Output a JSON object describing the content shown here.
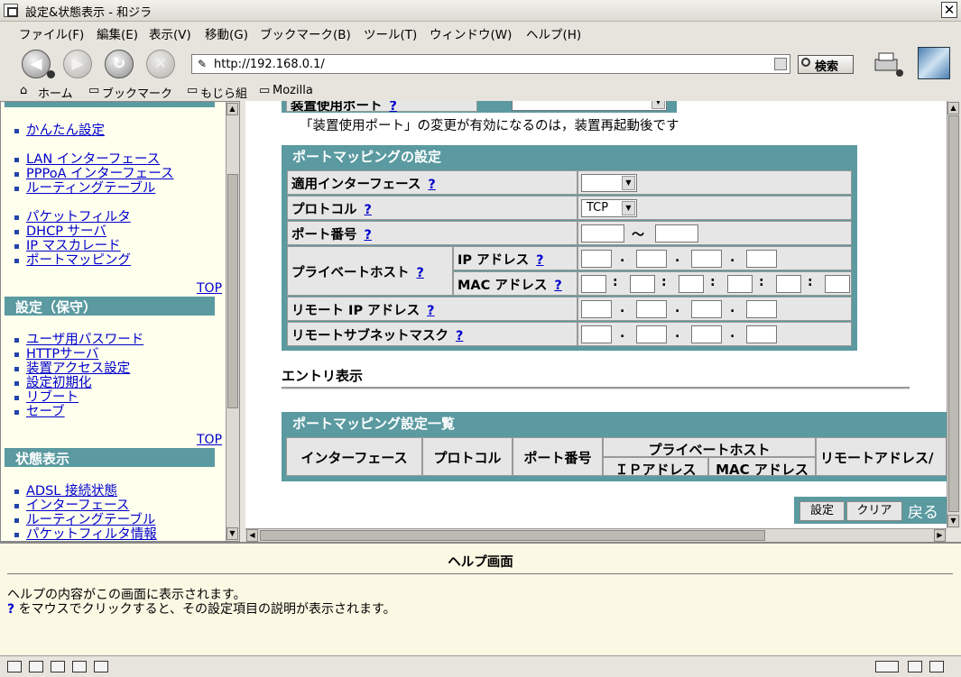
{
  "window": {
    "title": "設定&状態表示 - 和ジラ",
    "close_glyph": "✕"
  },
  "menu": [
    "ファイル(F)",
    "編集(E)",
    "表示(V)",
    "移動(G)",
    "ブックマーク(B)",
    "ツール(T)",
    "ウィンドウ(W)",
    "ヘルプ(H)"
  ],
  "toolbar": {
    "back_glyph": "◀",
    "forward_glyph": "▶",
    "reload_glyph": "↻",
    "stop_glyph": "✕",
    "url": "http://192.168.0.1/",
    "search_label": "検索"
  },
  "bookmarks": [
    "ホーム",
    "ブックマーク",
    "もじら組",
    "Mozilla"
  ],
  "sidebar": {
    "groups_top": [
      [
        "かんたん設定"
      ],
      [
        "LAN インターフェース",
        "PPPoA インターフェース",
        "ルーティングテーブル"
      ],
      [
        "パケットフィルタ",
        "DHCP サーバ",
        "IP マスカレード",
        "ポートマッピング"
      ]
    ],
    "top_label": "TOP",
    "maint_header": "設定（保守）",
    "maint_items": [
      "ユーザ用パスワード",
      "HTTPサーバ",
      "装置アクセス設定",
      "設定初期化",
      "リブート",
      "セーブ"
    ],
    "status_header": "状態表示",
    "status_items": [
      "ADSL 接続状態",
      "インターフェース",
      "ルーティングテーブル",
      "パケットフィルタ情報"
    ]
  },
  "content": {
    "cut_label": "装置使用ポート",
    "note": "「装置使用ポート」の変更が有効になるのは，装置再起動後です",
    "pm_title": "ポートマッピングの設定",
    "help_q": "?",
    "rows": {
      "iface": "適用インターフェース",
      "proto": "プロトコル",
      "proto_value": "TCP",
      "port": "ポート番号",
      "port_sep": "〜",
      "private": "プライベートホスト",
      "ip": "IP アドレス",
      "mac": "MAC アドレス",
      "remote_ip": "リモート IP アドレス",
      "remote_mask": "リモートサブネットマスク"
    },
    "entry_title": "エントリ表示",
    "list_title": "ポートマッピング設定一覧",
    "list_headers": {
      "iface": "インターフェース",
      "proto": "プロトコル",
      "port": "ポート番号",
      "private": "プライベートホスト",
      "ip": "ＩＰアドレス",
      "mac": "MAC アドレス",
      "remote": "リモートアドレス/"
    },
    "buttons": {
      "set": "設定",
      "clear": "クリア",
      "back": "戻る"
    }
  },
  "help": {
    "title": "ヘルプ画面",
    "line1": "ヘルプの内容がこの画面に表示されます。",
    "q": "?",
    "line2": " をマウスでクリックすると、その設定項目の説明が表示されます。"
  }
}
